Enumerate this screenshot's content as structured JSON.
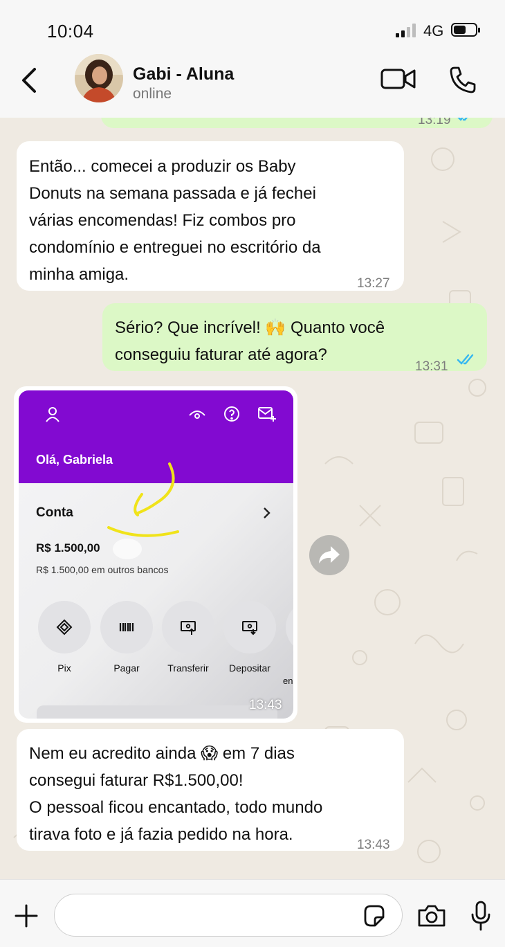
{
  "status_bar": {
    "time": "10:04",
    "network": "4G",
    "battery_level": 0.55
  },
  "header": {
    "name": "Gabi - Aluna",
    "presence": "online"
  },
  "messages": [
    {
      "type": "outgoing-partial",
      "time": "13:19"
    },
    {
      "type": "incoming",
      "text": "Então... comecei a produzir os Baby\nDonuts na semana passada e já fechei\nvárias encomendas! Fiz combos pro\ncondomínio e entreguei no escritório da\nminha amiga.",
      "time": "13:27"
    },
    {
      "type": "outgoing",
      "text": "Sério? Que incrível! 🙌  Quanto você\nconseguiu faturar até agora?",
      "time": "13:31"
    },
    {
      "type": "image",
      "time": "13:43"
    },
    {
      "type": "incoming",
      "text": "Nem eu acredito ainda 😱  em 7 dias\nconsegui faturar R$1.500,00!\nO pessoal ficou encantado, todo mundo\ntirava foto e já fazia pedido na hora.",
      "time": "13:43"
    }
  ],
  "bank_screenshot": {
    "greeting": "Olá, Gabriela",
    "account_label": "Conta",
    "balance": "R$ 1.500,00",
    "other_banks": "R$ 1.500,00 em outros bancos",
    "actions": [
      "Pix",
      "Pagar",
      "Transferir",
      "Depositar"
    ],
    "cutoff_label": "en"
  },
  "colors": {
    "incoming": "#ffffff",
    "outgoing": "#dcf8c6",
    "bank_purple": "#820ad1",
    "ticks": "#34b7f1"
  }
}
